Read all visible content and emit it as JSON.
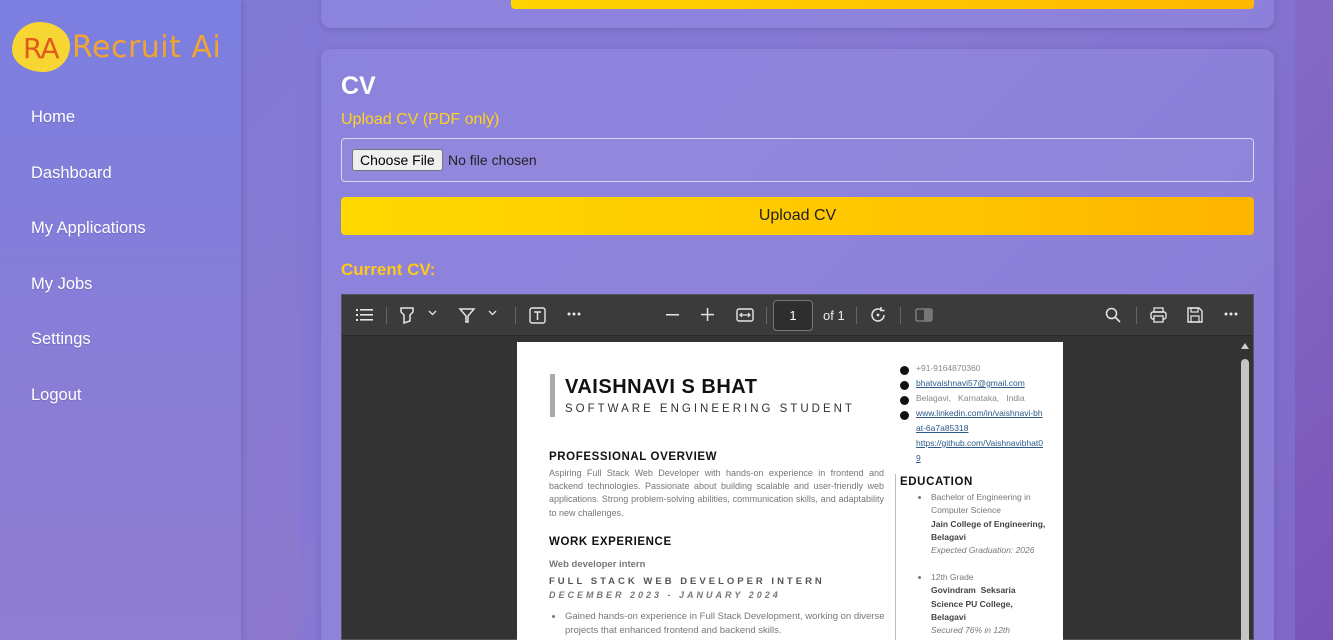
{
  "logo": {
    "mark": "RA",
    "text": "Recruit Ai"
  },
  "sidebar": {
    "items": [
      {
        "label": "Home"
      },
      {
        "label": "Dashboard"
      },
      {
        "label": "My Applications"
      },
      {
        "label": "My Jobs"
      },
      {
        "label": "Settings"
      },
      {
        "label": "Logout"
      }
    ]
  },
  "cv_section": {
    "title": "CV",
    "upload_label": "Upload CV (PDF only)",
    "choose_file_label": "Choose File",
    "file_status": "No file chosen",
    "upload_button": "Upload CV",
    "current_cv_label": "Current CV:"
  },
  "pdf_viewer": {
    "icons": [
      "list-icon",
      "highlight-icon",
      "chevron-down-icon",
      "draw-icon",
      "chevron-down-icon",
      "text-icon",
      "more-icon",
      "zoom-out-icon",
      "zoom-in-icon",
      "fit-width-icon",
      "rotate-icon",
      "two-page-icon",
      "search-icon",
      "print-icon",
      "save-icon",
      "more-icon"
    ],
    "page_current": "1",
    "page_total_label": "of 1"
  },
  "resume": {
    "name": "VAISHNAVI S BHAT",
    "role": "SOFTWARE ENGINEERING STUDENT",
    "overview_heading": "PROFESSIONAL OVERVIEW",
    "overview_text": "Aspiring Full Stack Web Developer with hands-on experience in frontend and backend technologies. Passionate about building scalable and user-friendly web applications. Strong problem-solving abilities, communication skills, and adaptability to new challenges.",
    "experience_heading": "WORK EXPERIENCE",
    "job_title": "Web developer intern",
    "job_position": "FULL STACK WEB DEVELOPER INTERN",
    "job_dates": "DECEMBER 2023 - JANUARY 2024",
    "job_bullet": "Gained hands-on experience in Full Stack Development, working on diverse projects that enhanced frontend and backend skills.",
    "contact": {
      "phone": "+91-9164870360",
      "email": "bhatvaishnavi57@gmail.com",
      "location": "Belagavi,   Karnataka,   India",
      "linkedin": "www.linkedin.com/in/vaishnavi-bhat-6a7a85318",
      "github": "https://github.com/Vaishnavibhat09"
    },
    "education_heading": "EDUCATION",
    "education": [
      {
        "degree": "Bachelor of Engineering in Computer Science",
        "institution": "Jain College of Engineering, Belagavi",
        "note": "Expected Graduation: 2026"
      },
      {
        "degree": "12th Grade",
        "institution": "Govindram  Seksaria Science PU College, Belagavi",
        "note": "Secured 76% in 12th"
      }
    ]
  },
  "colors": {
    "accent_yellow": "#ffd21f",
    "sidebar_bg": "#7b7fe0",
    "viewer_toolbar": "#3b3b3b"
  }
}
